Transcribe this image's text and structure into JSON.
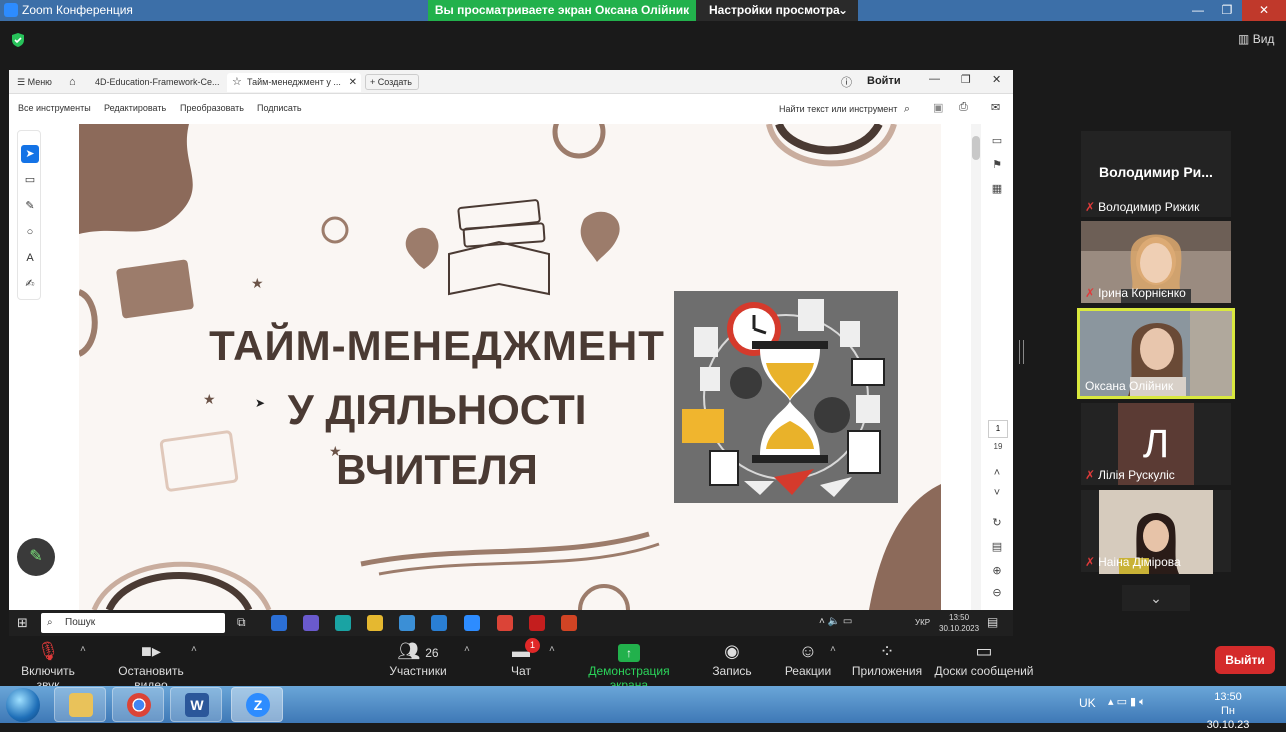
{
  "zoom": {
    "window_title": "Zoom Конференция",
    "share_banner": "Вы просматриваете экран Оксана Олійник",
    "view_settings": "Настройки просмотра",
    "view_button": "Вид"
  },
  "acrobat": {
    "menu_label": "Меню",
    "tab1": "4D-Education-Framework-Ce...",
    "tab2": "Тайм-менеджмент у ...",
    "create": "Создать",
    "login": "Войти",
    "menu": {
      "all_tools": "Все инструменты",
      "edit": "Редактировать",
      "convert": "Преобразовать",
      "sign": "Подписать",
      "find": "Найти текст или инструмент"
    },
    "page_current": "1",
    "page_total": "19"
  },
  "slide": {
    "line1": "ТАЙМ-МЕНЕДЖМЕНТ",
    "line2": "У ДІЯЛЬНОСТІ",
    "line3": "ВЧИТЕЛЯ"
  },
  "inner_taskbar": {
    "search": "Пошук",
    "lang": "УКР",
    "time": "13:50",
    "date": "30.10.2023"
  },
  "participants": [
    {
      "name": "Володимир Рижик",
      "big": "Володимир Ри..."
    },
    {
      "name": "Ірина Корнієнко"
    },
    {
      "name": "Оксана Олійник"
    },
    {
      "name": "Лілія Рускуліс",
      "initial": "Л"
    },
    {
      "name": "Наіна Дімірова"
    }
  ],
  "toolbar": {
    "unmute": "Включить звук",
    "stop_video": "Остановить видео",
    "participants": "Участники",
    "participants_count": "26",
    "chat": "Чат",
    "chat_badge": "1",
    "share": "Демонстрация экрана",
    "record": "Запись",
    "reactions": "Реакции",
    "apps": "Приложения",
    "whiteboards": "Доски сообщений",
    "leave": "Выйти"
  },
  "win_taskbar": {
    "lang": "UK",
    "time": "13:50",
    "date": "Пн 30.10.23"
  },
  "colors": {
    "share_green": "#22b14c",
    "leave_red": "#d42b2b",
    "slide_brown": "#4a3a33",
    "active_speaker": "#d9e83e"
  }
}
